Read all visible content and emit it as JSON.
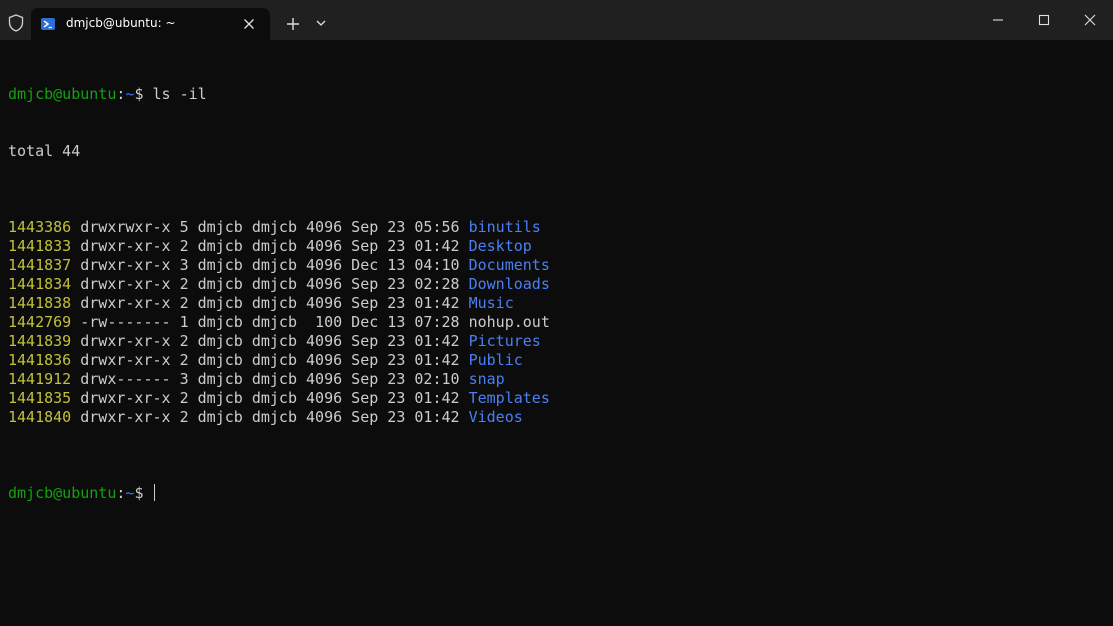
{
  "tab": {
    "title": "dmjcb@ubuntu: ~"
  },
  "prompt": {
    "user_host": "dmjcb@ubuntu",
    "colon": ":",
    "path": "~",
    "dollar": "$ "
  },
  "command": "ls -il",
  "total": "total 44",
  "entries": [
    {
      "inode": "1443386",
      "meta": " drwxrwxr-x 5 dmjcb dmjcb 4096 Sep 23 05:56 ",
      "name": "binutils",
      "is_dir": true
    },
    {
      "inode": "1441833",
      "meta": " drwxr-xr-x 2 dmjcb dmjcb 4096 Sep 23 01:42 ",
      "name": "Desktop",
      "is_dir": true
    },
    {
      "inode": "1441837",
      "meta": " drwxr-xr-x 3 dmjcb dmjcb 4096 Dec 13 04:10 ",
      "name": "Documents",
      "is_dir": true
    },
    {
      "inode": "1441834",
      "meta": " drwxr-xr-x 2 dmjcb dmjcb 4096 Sep 23 02:28 ",
      "name": "Downloads",
      "is_dir": true
    },
    {
      "inode": "1441838",
      "meta": " drwxr-xr-x 2 dmjcb dmjcb 4096 Sep 23 01:42 ",
      "name": "Music",
      "is_dir": true
    },
    {
      "inode": "1442769",
      "meta": " -rw------- 1 dmjcb dmjcb  100 Dec 13 07:28 ",
      "name": "nohup.out",
      "is_dir": false
    },
    {
      "inode": "1441839",
      "meta": " drwxr-xr-x 2 dmjcb dmjcb 4096 Sep 23 01:42 ",
      "name": "Pictures",
      "is_dir": true
    },
    {
      "inode": "1441836",
      "meta": " drwxr-xr-x 2 dmjcb dmjcb 4096 Sep 23 01:42 ",
      "name": "Public",
      "is_dir": true
    },
    {
      "inode": "1441912",
      "meta": " drwx------ 3 dmjcb dmjcb 4096 Sep 23 02:10 ",
      "name": "snap",
      "is_dir": true
    },
    {
      "inode": "1441835",
      "meta": " drwxr-xr-x 2 dmjcb dmjcb 4096 Sep 23 01:42 ",
      "name": "Templates",
      "is_dir": true
    },
    {
      "inode": "1441840",
      "meta": " drwxr-xr-x 2 dmjcb dmjcb 4096 Sep 23 01:42 ",
      "name": "Videos",
      "is_dir": true
    }
  ],
  "icons": {
    "shield": "shield-icon",
    "tab": "powershell-icon",
    "tab_close": "close-icon",
    "new_tab": "plus-icon",
    "dropdown": "chevron-down-icon",
    "minimize": "minimize-icon",
    "maximize": "maximize-icon",
    "close": "close-icon"
  },
  "colors": {
    "background": "#0c0c0c",
    "titlebar": "#202020",
    "prompt_green": "#13a10e",
    "path_blue": "#3b78ff",
    "dir_blue": "#4a7ff5",
    "inode_yellow": "#c1c13a",
    "text": "#cccccc"
  }
}
